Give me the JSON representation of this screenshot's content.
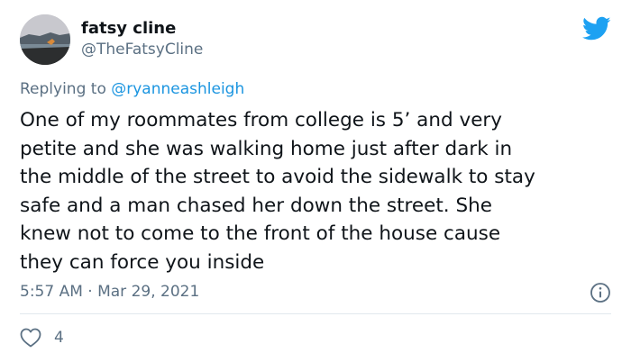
{
  "author": {
    "name": "fatsy cline",
    "handle": "@TheFatsyCline"
  },
  "reply": {
    "prefix": "Replying to ",
    "mention": "@ryanneashleigh"
  },
  "tweet": {
    "text": "One of my roommates from college is  5’ and very\npetite and she was walking home just after dark in\nthe middle of the street to avoid the sidewalk to stay\nsafe and a man chased her down the street. She\nknew not to come to the front of the house cause\nthey can force you inside",
    "timestamp": "5:57 AM · Mar 29, 2021"
  },
  "actions": {
    "like_count": "4"
  },
  "colors": {
    "twitter_blue": "#1da1f2",
    "secondary_text": "#5b7083",
    "mention": "#1b95e0"
  },
  "icons": {
    "brand": "twitter-bird-icon",
    "info": "info-icon",
    "like": "heart-icon"
  }
}
